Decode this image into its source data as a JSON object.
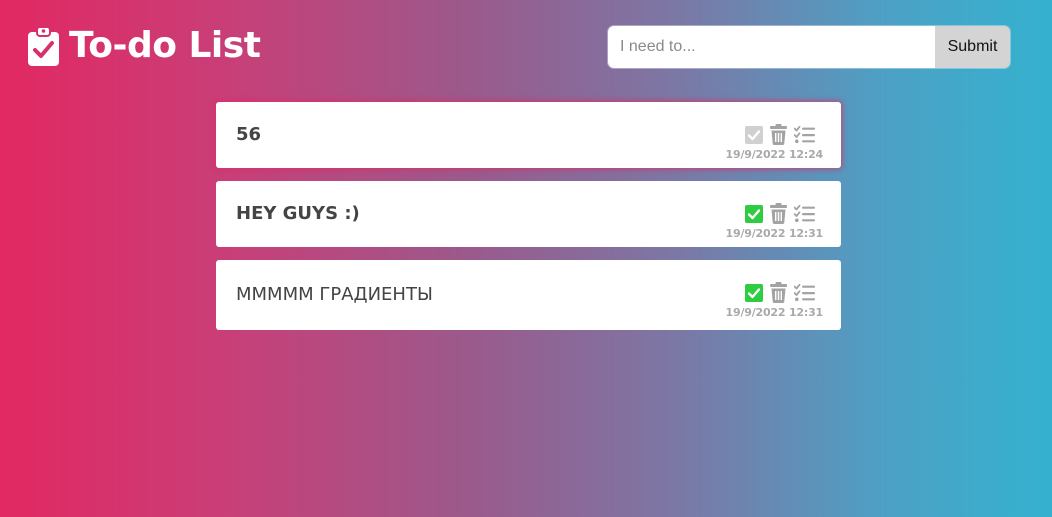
{
  "app": {
    "title": "To-do List",
    "logo_icon": "clipboard-check-icon"
  },
  "form": {
    "placeholder": "I need to...",
    "value": "",
    "submit_label": "Submit"
  },
  "colors": {
    "gradient_left": "#e22862",
    "gradient_right": "#35b1cf",
    "check_done": "#2ecc40",
    "check_pending": "#d0d0d0",
    "icon_gray": "#a3a3a3"
  },
  "todos": [
    {
      "text": "56",
      "completed": false,
      "timestamp": "19/9/2022 12:24"
    },
    {
      "text": "HEY GUYS :)",
      "completed": true,
      "timestamp": "19/9/2022 12:31"
    },
    {
      "text": "MMMMM ГРАДИЕНТЫ",
      "completed": true,
      "timestamp": "19/9/2022 12:31"
    }
  ]
}
